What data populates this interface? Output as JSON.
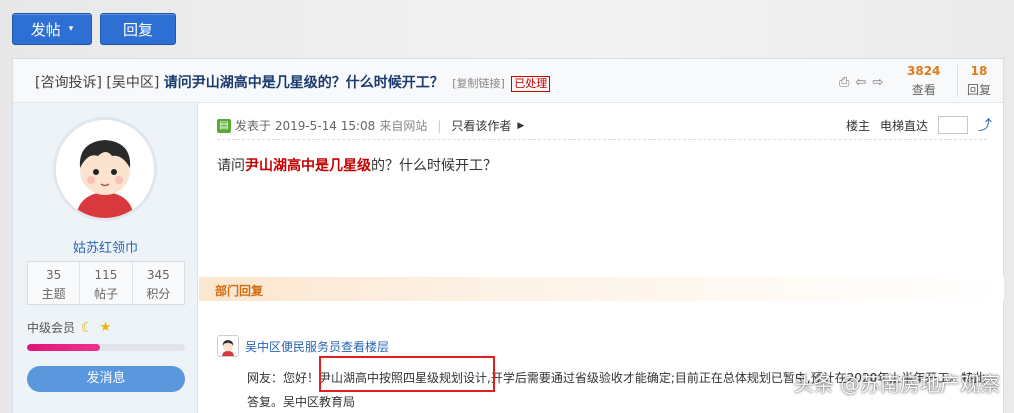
{
  "toolbar": {
    "post_label": "发帖",
    "post_caret": "▾",
    "reply_label": "回复"
  },
  "thread": {
    "category1": "[咨询投诉]",
    "category2": "[吴中区]",
    "title": "请问尹山湖高中是几星级的？什么时候开工？",
    "copy_link": "[复制链接]",
    "status_badge": "已处理",
    "views_count": "3824",
    "views_label": "查看",
    "replies_count": "18",
    "replies_label": "回复",
    "icons": [
      "print-icon",
      "prev-icon",
      "next-icon"
    ]
  },
  "sidebar": {
    "username": "姑苏红领巾",
    "stats": [
      {
        "n": "35",
        "l": "主题"
      },
      {
        "n": "115",
        "l": "帖子"
      },
      {
        "n": "345",
        "l": "积分"
      }
    ],
    "level_label": "中级会员",
    "level_progress": 0.46,
    "message_button": "发消息"
  },
  "post": {
    "meta_posted": "发表于 2019-5-14 15:08",
    "meta_source": "来自网站",
    "meta_sep": "|",
    "author_only": "只看该作者",
    "floor_owner": "楼主",
    "jump_label": "电梯直达",
    "body_prefix": "请问",
    "body_highlight": "尹山湖高中是几星级",
    "body_suffix": "的？什么时候开工？"
  },
  "dept_reply": {
    "section_title": "部门回复",
    "name": "吴中区便民服务员查看楼层",
    "line1": "网友：您好！尹山湖高中按照四星级规划设计,开学后需要通过省级验收才能确定;目前正在总体规划已暂中,预计在2020年上半年开工。特此",
    "line2": "答复。吴中区教育局"
  },
  "watermark": "头条 @苏南房地产观察",
  "colors": {
    "accent_blue": "#2d6fd3",
    "badge_red": "#cc0000",
    "count_orange": "#e07a1a",
    "dept_orange": "#d36b10"
  }
}
